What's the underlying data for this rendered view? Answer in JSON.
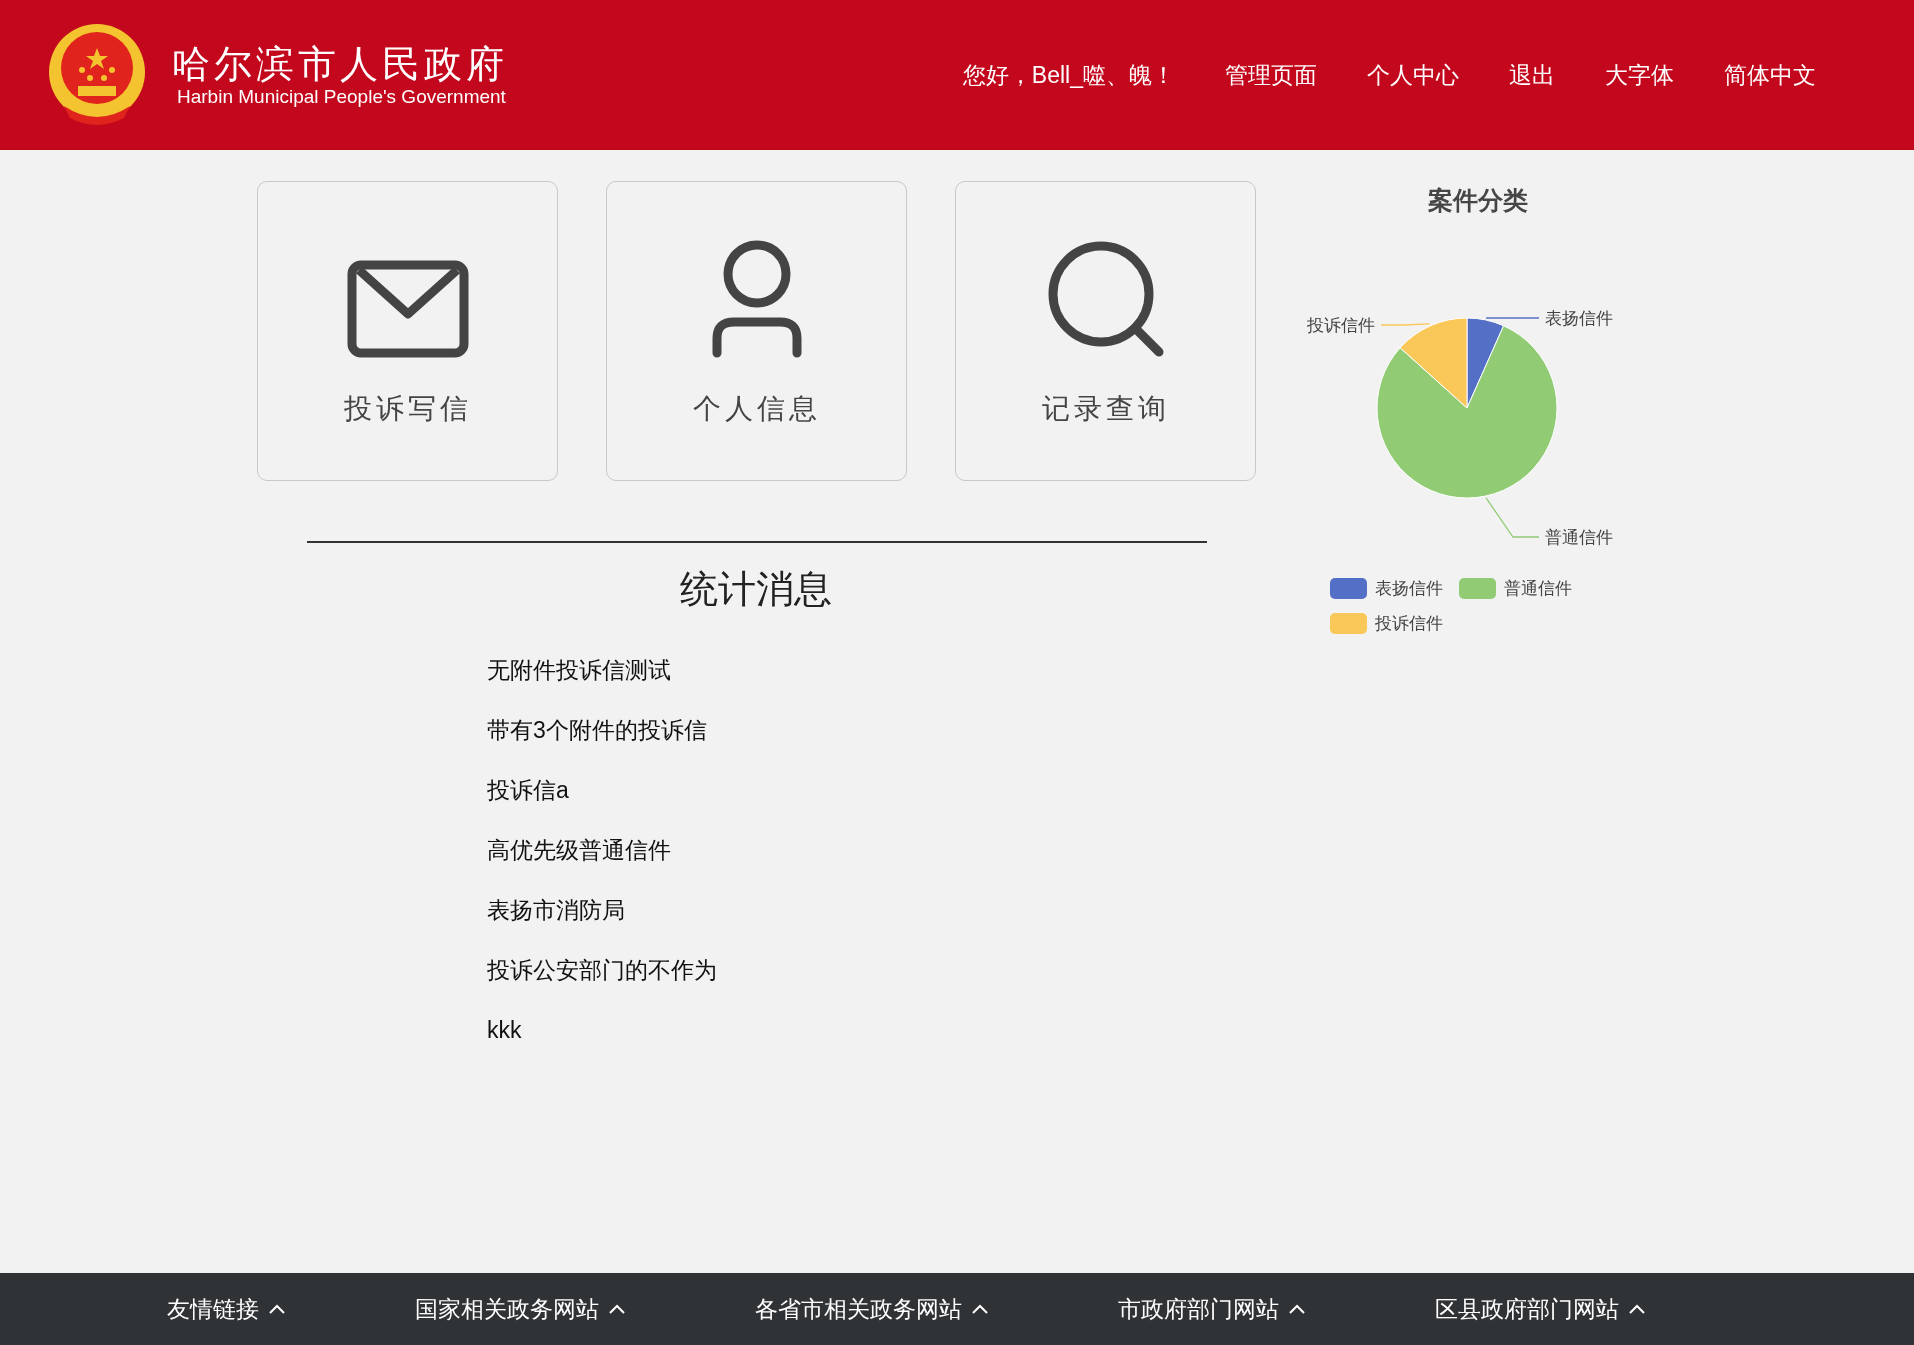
{
  "header": {
    "title": "哈尔滨市人民政府",
    "subtitle": "Harbin Municipal People's Government",
    "nav": [
      "您好，Bell_噬、魄！",
      "管理页面",
      "个人中心",
      "退出",
      "大字体",
      "简体中文"
    ]
  },
  "cards": [
    {
      "kind": "mail",
      "label": "投诉写信"
    },
    {
      "kind": "person",
      "label": "个人信息"
    },
    {
      "kind": "search",
      "label": "记录查询"
    }
  ],
  "stats": {
    "title": "统计消息",
    "items": [
      "无附件投诉信测试",
      "带有3个附件的投诉信",
      "投诉信a",
      "高优先级普通信件",
      "表扬市消防局",
      "投诉公安部门的不作为",
      "kkk"
    ]
  },
  "pie": {
    "title": "案件分类",
    "slices": [
      {
        "name": "表扬信件",
        "color": "#5470c6"
      },
      {
        "name": "普通信件",
        "color": "#91cc75"
      },
      {
        "name": "投诉信件",
        "color": "#fac858"
      }
    ],
    "legend": [
      {
        "name": "表扬信件",
        "color": "#5470c6"
      },
      {
        "name": "普通信件",
        "color": "#91cc75"
      },
      {
        "name": "投诉信件",
        "color": "#fac858"
      }
    ]
  },
  "footer": [
    "友情链接",
    "国家相关政务网站",
    "各省市相关政务网站",
    "市政府部门网站",
    "区县政府部门网站"
  ]
}
